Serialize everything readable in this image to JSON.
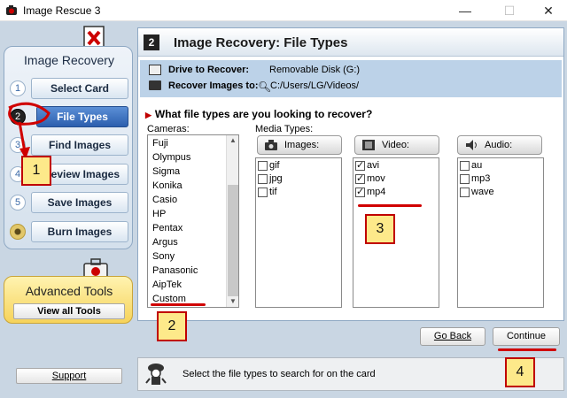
{
  "window": {
    "title": "Image Rescue 3"
  },
  "sidebar": {
    "heading": "Image Recovery",
    "steps": [
      {
        "num": "1",
        "label": "Select Card"
      },
      {
        "num": "2",
        "label": "File Types"
      },
      {
        "num": "3",
        "label": "Find Images"
      },
      {
        "num": "4",
        "label": "Preview Images"
      },
      {
        "num": "5",
        "label": "Save Images"
      },
      {
        "num": "",
        "label": "Burn Images"
      }
    ]
  },
  "advanced": {
    "heading": "Advanced Tools",
    "button": "View all Tools"
  },
  "main": {
    "step_num": "2",
    "title": "Image Recovery: File Types",
    "drive_label": "Drive to Recover:",
    "drive_value": "Removable Disk (G:)",
    "recover_label": "Recover Images to:",
    "recover_value": "C:/Users/LG/Videos/",
    "question": "What file types are you looking to recover?",
    "cameras_label": "Cameras:",
    "cameras": [
      "Fuji",
      "Olympus",
      "Sigma",
      "Konika",
      "Casio",
      "HP",
      "Pentax",
      "Argus",
      "Sony",
      "Panasonic",
      "AipTek",
      "Custom"
    ],
    "media_label": "Media Types:",
    "images_button": "Images:",
    "video_button": "Video:",
    "audio_button": "Audio:",
    "images": [
      {
        "label": "gif",
        "checked": false
      },
      {
        "label": "jpg",
        "checked": false
      },
      {
        "label": "tif",
        "checked": false
      }
    ],
    "video": [
      {
        "label": "avi",
        "checked": true
      },
      {
        "label": "mov",
        "checked": true
      },
      {
        "label": "mp4",
        "checked": true
      }
    ],
    "audio": [
      {
        "label": "au",
        "checked": false
      },
      {
        "label": "mp3",
        "checked": false
      },
      {
        "label": "wave",
        "checked": false
      }
    ]
  },
  "footer": {
    "go_back": "Go Back",
    "continue": "Continue",
    "support": "Support",
    "status_message": "Select the file types to search for on the card"
  },
  "annotations": [
    "1",
    "2",
    "3",
    "4"
  ],
  "colors": {
    "accent": "#2c5fae",
    "annotation_red": "#d00000",
    "annotation_fill": "#fde98a"
  }
}
